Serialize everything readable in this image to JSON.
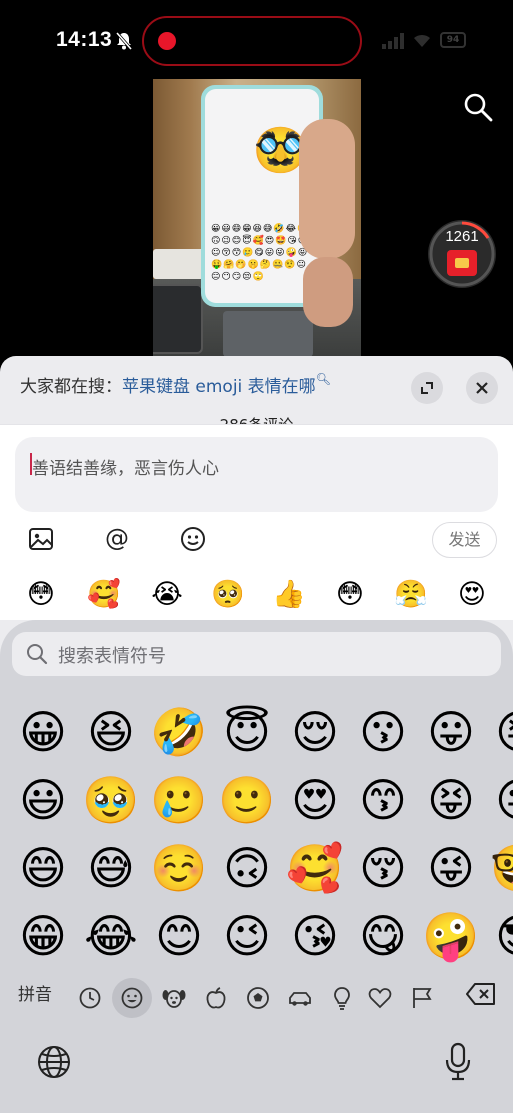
{
  "status_bar": {
    "time": "14:13",
    "battery": "94"
  },
  "video": {
    "big_emoji": "🥸",
    "phone_emoji_grid": "😀😃😄😁😆😅🤣😂🙂🙃😉😊😇🥰😍🤩😘😗☺😚😙🥲😋😛😜🤪😝🤑🤗🤭🤫🤔🤐🤨😐😑😶😏😒🙄"
  },
  "redpacket": {
    "count": "1261",
    "accent": "#e6202a"
  },
  "sheet": {
    "search_prefix": "大家都在搜：",
    "search_query": "苹果键盘 emoji 表情在哪",
    "comment_count": "286条评论"
  },
  "comment_input": {
    "placeholder": "善语结善缘，恶言伤人心"
  },
  "toolbar": {
    "send_label": "发送"
  },
  "quick_emojis": [
    "😳",
    "🥰",
    "😭",
    "🥺",
    "👍",
    "😳",
    "😤",
    "😍"
  ],
  "keyboard": {
    "search_placeholder": "搜索表情符号",
    "emoji_rows": [
      [
        "😀",
        "😆",
        "🤣",
        "😇",
        "😌",
        "😗",
        "😛",
        "😝"
      ],
      [
        "😃",
        "🥹",
        "🥲",
        "🙂",
        "😍",
        "😙",
        "😝",
        "😜"
      ],
      [
        "😄",
        "😅",
        "☺️",
        "🙃",
        "🥰",
        "😚",
        "😜",
        "🤓"
      ],
      [
        "😁",
        "😂",
        "😊",
        "😉",
        "😘",
        "😋",
        "🤪",
        "😎"
      ]
    ],
    "pinyin_label": "拼音",
    "categories": [
      "recent-icon",
      "smileys-icon",
      "animals-icon",
      "food-icon",
      "activity-icon",
      "travel-icon",
      "objects-icon",
      "symbols-icon",
      "flags-icon"
    ]
  }
}
